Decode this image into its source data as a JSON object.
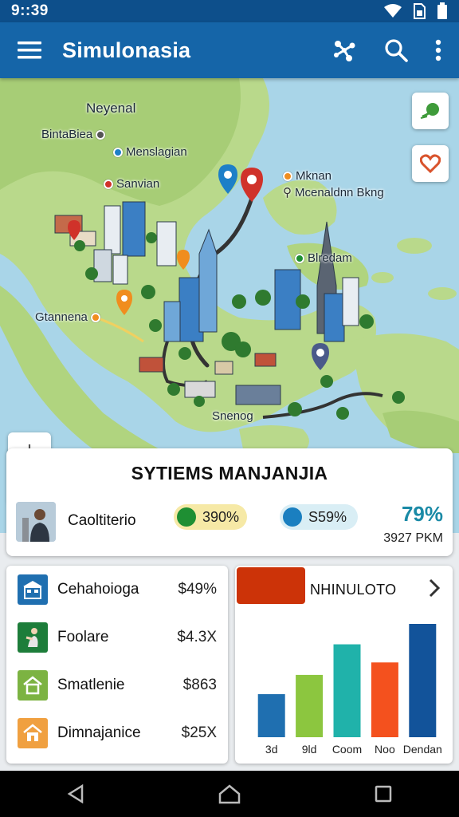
{
  "status_bar": {
    "time": "9::39"
  },
  "app_bar": {
    "title": "Simulonasia",
    "icons": [
      "menu-icon",
      "network-icon",
      "search-icon",
      "more-vert-icon"
    ]
  },
  "map": {
    "labels": {
      "neyenal": "Neyenal",
      "bintabiea": "BintaBiea",
      "menslagian": "Menslagian",
      "sanvian": "Sanvian",
      "mknan": "Mknan",
      "mcenaldnn": "Mcenaldnn Bkng",
      "blredam": "Blredam",
      "gtannena": "Gtannena",
      "snenog": "Snenog"
    },
    "controls": {
      "zoom_in": "+",
      "zoom_out": "–"
    }
  },
  "summary": {
    "title": "SYTIEMS MANJANJIA",
    "person": "Caoltiterio",
    "pill_a": "390%",
    "pill_b": "S59%",
    "big_percent": "79%",
    "distance": "3927 PKM"
  },
  "list": [
    {
      "name": "Cehahoioga",
      "value": "$49%",
      "icon": "building-icon",
      "color": "#1f6fb0"
    },
    {
      "name": "Foolare",
      "value": "$4.3X",
      "icon": "person-icon",
      "color": "#1d7d3a"
    },
    {
      "name": "Smatlenie",
      "value": "$863",
      "icon": "home-icon",
      "color": "#7cb342"
    },
    {
      "name": "Dimnajanice",
      "value": "$25X",
      "icon": "house-icon",
      "color": "#f0a040"
    }
  ],
  "chart_card": {
    "title": "NHINULOTO",
    "chart_data": {
      "type": "bar",
      "categories": [
        "3d",
        "9ld",
        "Coom",
        "Noo",
        "Dendan"
      ],
      "values": [
        38,
        55,
        82,
        66,
        100
      ],
      "colors": [
        "#1f6fb0",
        "#8cc63f",
        "#20b2aa",
        "#f4511e",
        "#12539a"
      ],
      "ylim": [
        0,
        100
      ]
    }
  }
}
